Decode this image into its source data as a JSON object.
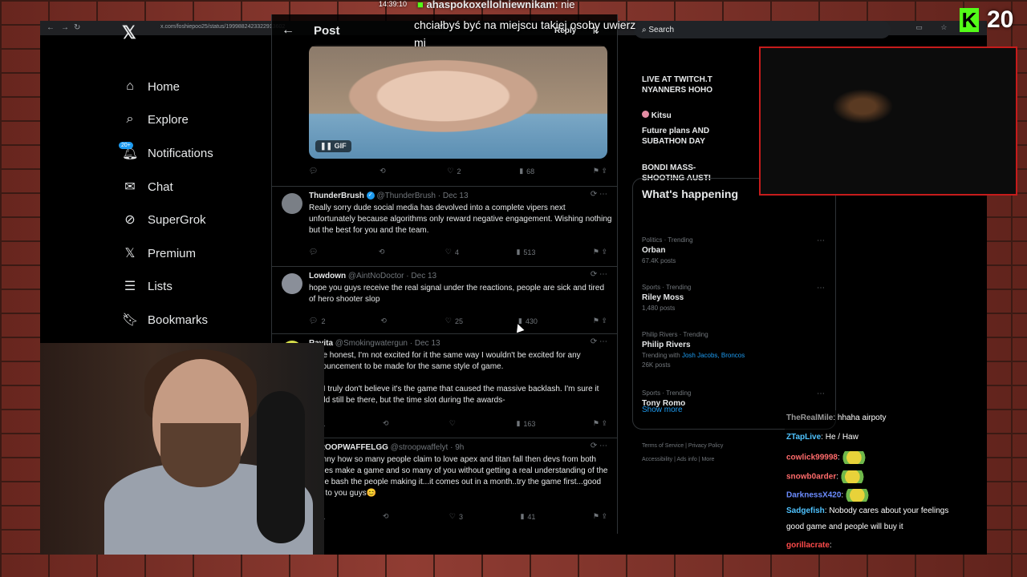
{
  "overlay": {
    "clock": "14:39:10",
    "top_message_user": "ahaspokoxellolniewnikam",
    "top_message_text": ": nie",
    "chat_message": "chciałbyś być na miejscu takiej osoby uwierz mi",
    "kick_logo": "K",
    "viewer_count": "20"
  },
  "browser": {
    "url": "x.com/foshiepoo25/status/1999882423322913602",
    "zoom": "110%"
  },
  "sidebar": {
    "items": [
      {
        "label": "Home",
        "icon": "home-icon"
      },
      {
        "label": "Explore",
        "icon": "search-icon"
      },
      {
        "label": "Notifications",
        "icon": "bell-icon",
        "badge": "20+"
      },
      {
        "label": "Chat",
        "icon": "mail-icon"
      },
      {
        "label": "SuperGrok",
        "icon": "grok-icon"
      },
      {
        "label": "Premium",
        "icon": "x-icon"
      },
      {
        "label": "Lists",
        "icon": "list-icon"
      },
      {
        "label": "Bookmarks",
        "icon": "bookmark-icon"
      }
    ]
  },
  "post": {
    "title": "Post",
    "reply_label": "Reply",
    "media_badge": "GIF",
    "main_actions": {
      "replies": "",
      "retweets": "",
      "likes": "2",
      "views": "68"
    }
  },
  "tweets": [
    {
      "name": "ThunderBrush",
      "verified": true,
      "handle": "@ThunderBrush",
      "date": "Dec 13",
      "text": "Really sorry dude social media has devolved into a complete vipers next unfortunately because algorithms only reward negative engagement. Wishing nothing but the best for you and the team.",
      "replies": "",
      "retweets": "",
      "likes": "4",
      "views": "513",
      "avatar_color": "#7a7f86"
    },
    {
      "name": "Lowdown",
      "verified": false,
      "handle": "@AintNoDoctor",
      "date": "Dec 13",
      "text": "hope you guys receive the real signal under the reactions, people are sick and tired of hero shooter slop",
      "replies": "2",
      "retweets": "",
      "likes": "25",
      "views": "430",
      "avatar_color": "#8a8f99"
    },
    {
      "name": "Ravita",
      "verified": false,
      "handle": "@Smokingwatergun",
      "date": "Dec 13",
      "text": "I'll be honest, I'm not excited for it the same way I wouldn't be excited for any announcement to be made for the same style of game.",
      "text2": "But I truly don't believe it's the game that caused the massive backlash. I'm sure it would still be there, but the time slot during the awards-",
      "replies": "1",
      "retweets": "",
      "likes": "",
      "views": "163",
      "avatar_color": "#d8e04a"
    },
    {
      "name": "STROOPWAFFELGG",
      "verified": false,
      "handle": "@stroopwaffelyt",
      "date": "9h",
      "text": "It funny how so many people claim to love apex and titan fall then devs from both games make a game and so many of you without getting a real understanding of the game bash the people making it...it comes out in a month..try the game first...good luck to you guys😊",
      "replies": "1",
      "retweets": "",
      "likes": "3",
      "views": "41",
      "avatar_color": "#e0c6b5"
    }
  ],
  "right": {
    "search_placeholder": "Search",
    "top_trends": [
      {
        "line1": "LIVE AT TWITCH.T",
        "line2": "NYANNERS HOHO"
      },
      {
        "user": "Kitsu",
        "line1": "Future plans AND",
        "line2": "SUBATHON DAY"
      },
      {
        "line1": "BONDI MASS-",
        "line2": "SHOOTING AUSTI"
      }
    ],
    "whats_happening_title": "What's happening",
    "trends": [
      {
        "category": "Politics · Trending",
        "name": "Orban",
        "posts": "67.4K posts"
      },
      {
        "category": "Sports · Trending",
        "name": "Riley Moss",
        "posts": "1,480 posts"
      },
      {
        "category": "Philip Rivers · Trending",
        "name": "Philip Rivers",
        "context_prefix": "Trending with ",
        "context_links": "Josh Jacobs, Broncos",
        "posts": "26K posts"
      },
      {
        "category": "Sports · Trending",
        "name": "Tony Romo",
        "posts": ""
      }
    ],
    "show_more": "Show more",
    "footer": [
      "Terms of Service",
      "Privacy Policy",
      "Accessibility",
      "Ads info",
      "More"
    ]
  },
  "chat": [
    {
      "user": "TheRealMile",
      "text": "hhaha airpoty",
      "color": "#9a9a9a"
    },
    {
      "user": "ZTapLive",
      "text": "He / Haw",
      "color": "#4fc3ff"
    },
    {
      "user": "cowlick99998",
      "text": "",
      "color": "#ff6b6b",
      "emote": true
    },
    {
      "user": "snowb0arder",
      "text": "",
      "color": "#ff6b6b",
      "emote": true
    },
    {
      "user": "DarknessX420",
      "text": "",
      "color": "#6b8cff",
      "emote": true
    },
    {
      "user": "Sadgefish",
      "text": "Nobody cares about your feelings",
      "color": "#4fc3ff"
    },
    {
      "user": "",
      "text": "good game and people will buy it",
      "color": "#ffffff"
    },
    {
      "user": "gorillacrate",
      "text": "",
      "color": "#ff4b4b"
    }
  ]
}
